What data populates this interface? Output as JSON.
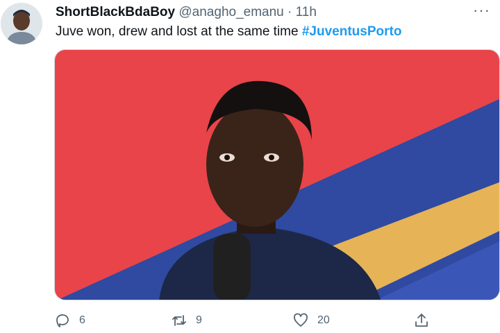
{
  "tweet": {
    "display_name": "ShortBlackBdaBoy",
    "handle": "@anagho_emanu",
    "separator": "·",
    "time": "11h",
    "text": "Juve won, drew and lost at the same time ",
    "hashtag": "#JuventusPorto",
    "more_label": "···"
  },
  "actions": {
    "reply_count": "6",
    "retweet_count": "9",
    "like_count": "20"
  },
  "icons": [
    "avatar",
    "more-icon",
    "reply-icon",
    "retweet-icon",
    "like-icon",
    "share-icon"
  ],
  "colors": {
    "hashtag": "#1d9bf0",
    "muted": "#536471",
    "text": "#0f1419"
  }
}
